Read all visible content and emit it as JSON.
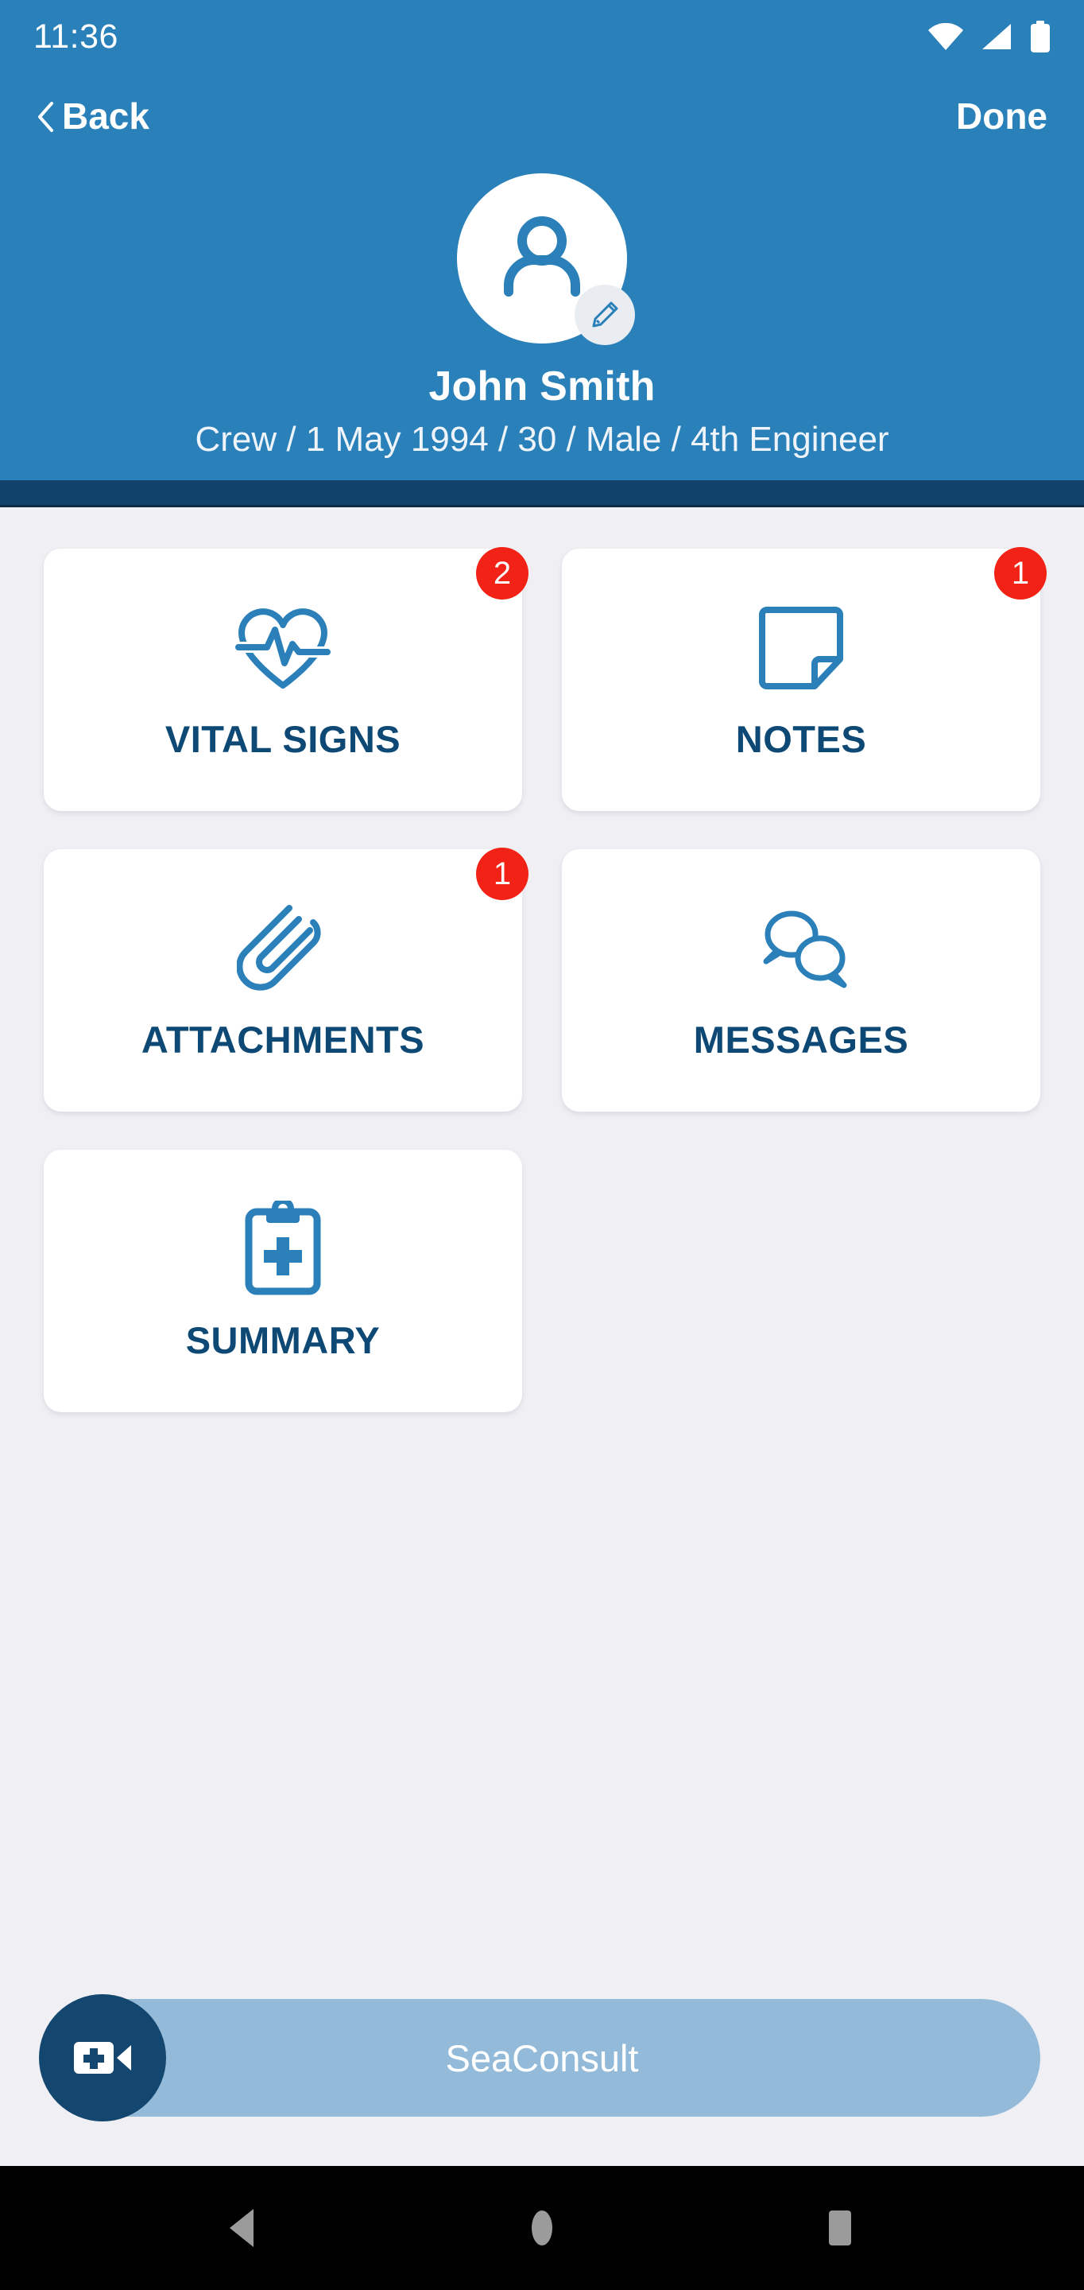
{
  "statusbar": {
    "time": "11:36",
    "icons": [
      "wifi-icon",
      "cellular-signal-icon",
      "battery-icon"
    ]
  },
  "navbar": {
    "back_label": "Back",
    "back_icon": "chevron-left-icon",
    "done_label": "Done"
  },
  "profile": {
    "avatar_icon": "person-icon",
    "edit_icon": "pencil-icon",
    "name": "John Smith",
    "details": "Crew / 1 May 1994 / 30 / Male / 4th Engineer"
  },
  "cards": [
    {
      "label": "VITAL SIGNS",
      "icon": "heart-pulse-icon",
      "badge": "2"
    },
    {
      "label": "NOTES",
      "icon": "note-page-icon",
      "badge": "1"
    },
    {
      "label": "ATTACHMENTS",
      "icon": "paperclip-icon",
      "badge": "1"
    },
    {
      "label": "MESSAGES",
      "icon": "chat-bubbles-icon",
      "badge": ""
    },
    {
      "label": "SUMMARY",
      "icon": "clipboard-medical-icon",
      "badge": ""
    }
  ],
  "bottom_action": {
    "label": "SeaConsult",
    "icon": "video-call-plus-icon"
  },
  "android_nav": {
    "back": "triangle-back-icon",
    "home": "circle-home-icon",
    "recents": "square-recents-icon"
  },
  "colors": {
    "header_blue": "#2a80b9",
    "divider_navy": "#114269",
    "icon_blue": "#2b80b9",
    "label_navy": "#0d4974",
    "badge_red": "#f22316",
    "card_white": "#ffffff",
    "page_bg": "#f0f0f4",
    "consult_bar": "#93bbd9",
    "consult_fab": "#14476f"
  }
}
